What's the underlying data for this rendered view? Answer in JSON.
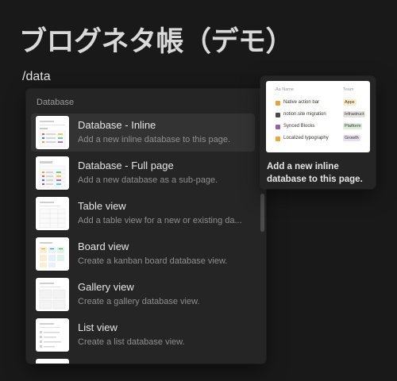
{
  "page": {
    "title": "ブログネタ帳（デモ）",
    "command": "/data"
  },
  "menu": {
    "section": "Database",
    "items": [
      {
        "title": "Database - Inline",
        "desc": "Add a new inline database to this page.",
        "active": true
      },
      {
        "title": "Database - Full page",
        "desc": "Add a new database as a sub-page."
      },
      {
        "title": "Table view",
        "desc": "Add a table view for a new or existing da..."
      },
      {
        "title": "Board view",
        "desc": "Create a kanban board database view."
      },
      {
        "title": "Gallery view",
        "desc": "Create a gallery database view."
      },
      {
        "title": "List view",
        "desc": "Create a list database view."
      }
    ]
  },
  "preview": {
    "header_name": "Aa Name",
    "header_team": "Team",
    "rows": [
      {
        "name": "Native action bar",
        "tag": "Apps",
        "tag_color": "#fdecc8",
        "icon_color": "#e9a23b"
      },
      {
        "name": "notion.site migration",
        "tag": "Infrastruct",
        "tag_color": "#e3e2e0",
        "icon_color": "#4a4a4a"
      },
      {
        "name": "Synced Blocks",
        "tag": "Platform",
        "tag_color": "#dbeddb",
        "icon_color": "#9065b0"
      },
      {
        "name": "Localized typography",
        "tag": "Growth",
        "tag_color": "#e8deee",
        "icon_color": "#f2a33a"
      }
    ],
    "caption": "Add a new inline database to this page."
  }
}
